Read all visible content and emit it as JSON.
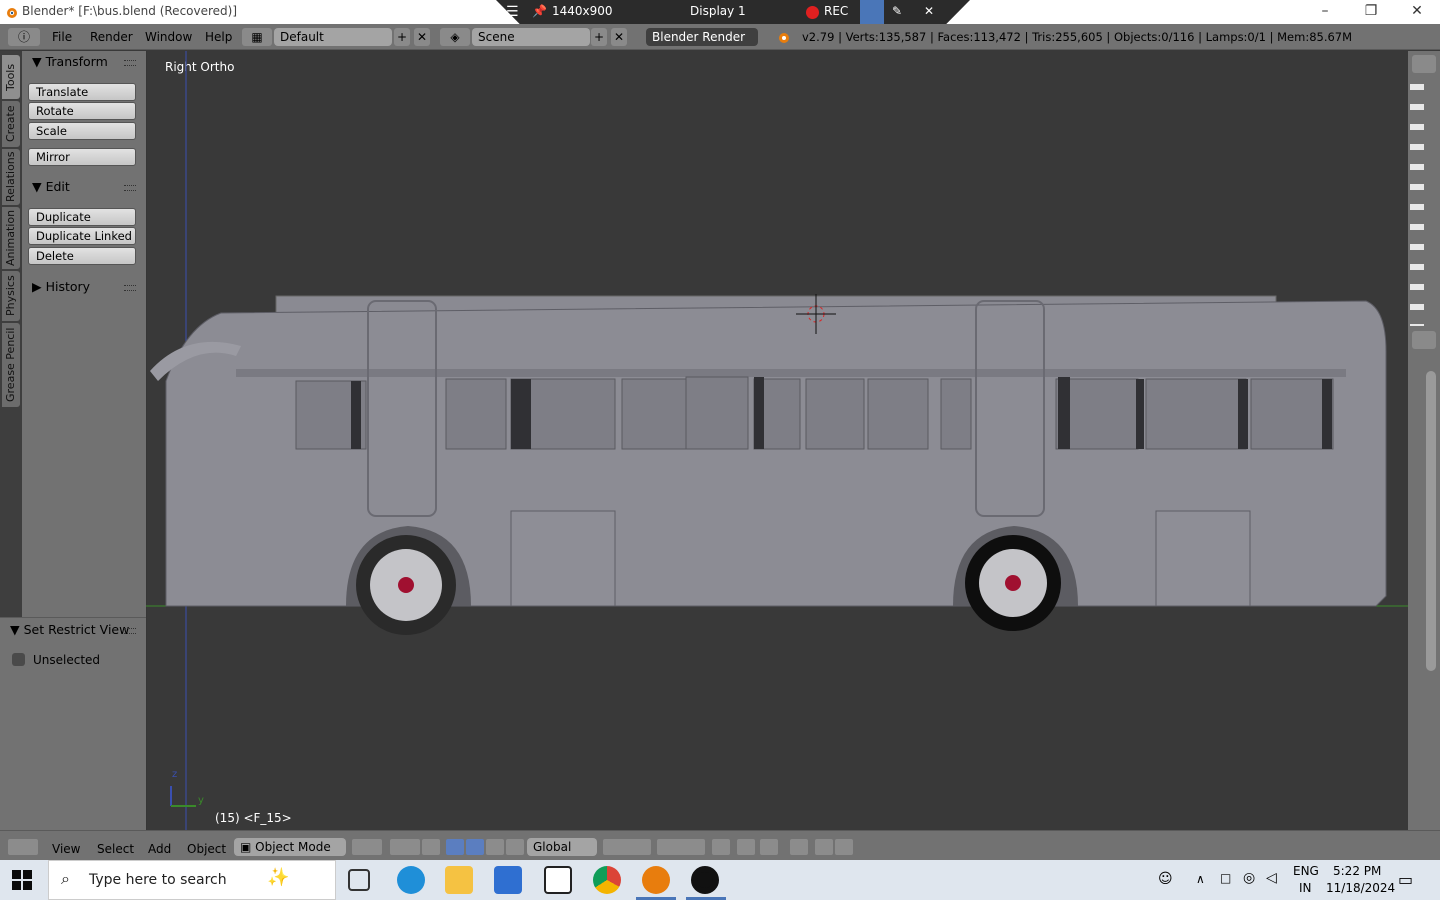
{
  "window": {
    "title": "Blender* [F:\\bus.blend (Recovered)]"
  },
  "recorder": {
    "resolution": "1440x900",
    "display": "Display 1",
    "rec_label": "REC"
  },
  "menu": {
    "items": [
      "File",
      "Render",
      "Window",
      "Help"
    ]
  },
  "header": {
    "layout": "Default",
    "scene": "Scene",
    "engine": "Blender Render",
    "stats": "v2.79 | Verts:135,587 | Faces:113,472 | Tris:255,605 | Objects:0/116 | Lamps:0/1 | Mem:85.67M"
  },
  "tabs": [
    "Tools",
    "Create",
    "Relations",
    "Animation",
    "Physics",
    "Grease Pencil"
  ],
  "tools": {
    "transform": {
      "title": "Transform",
      "buttons": [
        "Translate",
        "Rotate",
        "Scale"
      ]
    },
    "mirror": "Mirror",
    "edit": {
      "title": "Edit",
      "buttons": [
        "Duplicate",
        "Duplicate Linked",
        "Delete"
      ]
    },
    "history": "History"
  },
  "restrict": {
    "title": "Set Restrict View",
    "checkbox": "Unselected"
  },
  "viewport": {
    "view_name": "Right Ortho",
    "frame_info": "(15) <F_15>",
    "axis_z": "z",
    "axis_y": "y"
  },
  "bottom": {
    "menus": [
      "View",
      "Select",
      "Add",
      "Object"
    ],
    "mode": "Object Mode",
    "orientation": "Global"
  },
  "taskbar": {
    "search_placeholder": "Type here to search",
    "lang_1": "ENG",
    "lang_2": "IN",
    "time": "5:22 PM",
    "date": "11/18/2024"
  },
  "colors": {
    "accent": "#4a76b8",
    "rec": "#e02020",
    "background": "#393939",
    "panel": "#727272"
  }
}
